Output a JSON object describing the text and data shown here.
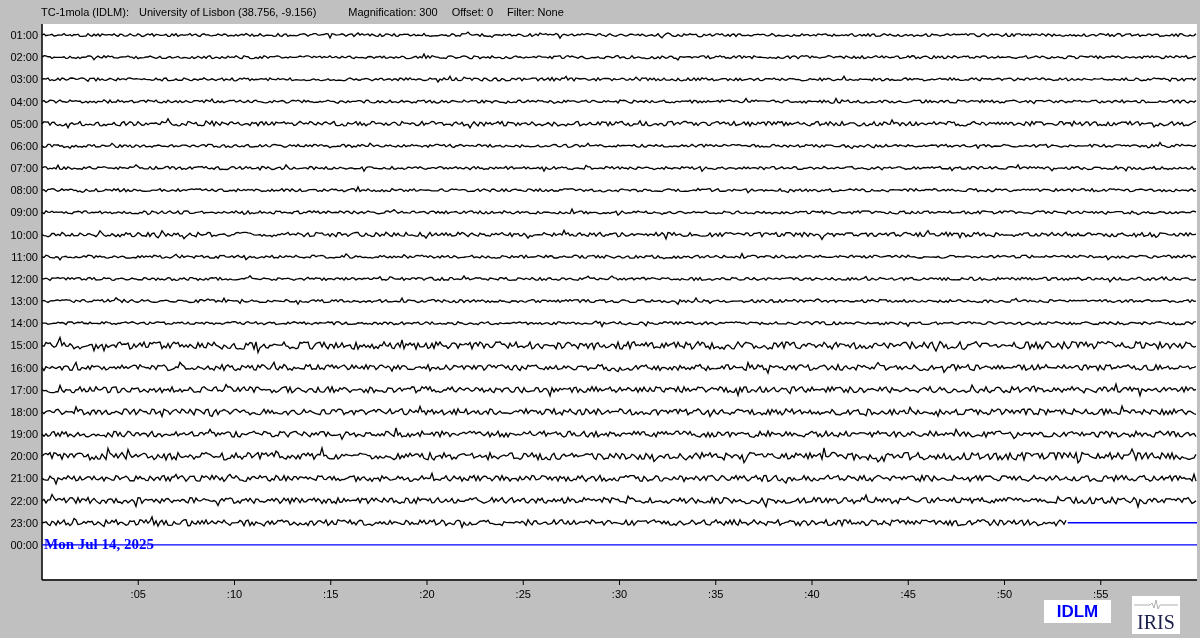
{
  "header": {
    "station": "TC-1mola (IDLM):",
    "location": "University of Lisbon (38.756, -9.156)",
    "magnification": "Magnification: 300",
    "offset": "Offset: 0",
    "filter": "Filter: None"
  },
  "traces": [
    {
      "hour": "01:00",
      "level": 1
    },
    {
      "hour": "02:00",
      "level": 1
    },
    {
      "hour": "03:00",
      "level": 1
    },
    {
      "hour": "04:00",
      "level": 1
    },
    {
      "hour": "05:00",
      "level": 1
    },
    {
      "hour": "06:00",
      "level": 1
    },
    {
      "hour": "07:00",
      "level": 1
    },
    {
      "hour": "08:00",
      "level": 1
    },
    {
      "hour": "09:00",
      "level": 1
    },
    {
      "hour": "10:00",
      "level": 1
    },
    {
      "hour": "11:00",
      "level": 1
    },
    {
      "hour": "12:00",
      "level": 1
    },
    {
      "hour": "13:00",
      "level": 1
    },
    {
      "hour": "14:00",
      "level": 1
    },
    {
      "hour": "15:00",
      "level": 1
    },
    {
      "hour": "16:00",
      "level": 1
    },
    {
      "hour": "17:00",
      "level": 1
    },
    {
      "hour": "18:00",
      "level": 1
    },
    {
      "hour": "19:00",
      "level": 1
    },
    {
      "hour": "20:00",
      "level": 1
    },
    {
      "hour": "21:00",
      "level": 1
    },
    {
      "hour": "22:00",
      "level": 1
    },
    {
      "hour": "23:00",
      "level": 0.888
    },
    {
      "hour": "00:00",
      "level": 0
    }
  ],
  "date": "Mon Jul 14, 2025",
  "minute_ticks": [
    ":05",
    ":10",
    ":15",
    ":20",
    ":25",
    ":30",
    ":35",
    ":40",
    ":45",
    ":50",
    ":55"
  ],
  "logos": {
    "station": "IDLM",
    "network": "IRIS"
  }
}
